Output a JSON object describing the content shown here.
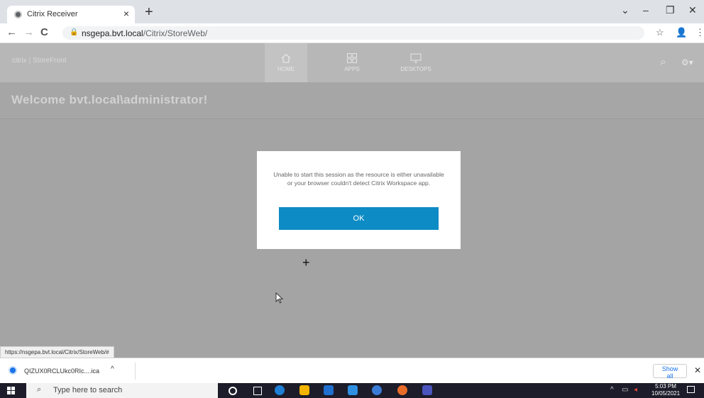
{
  "browser": {
    "tab_title": "Citrix Receiver",
    "tab_close": "×",
    "new_tab": "+",
    "window_controls": {
      "menu": "⌄",
      "minimize": "–",
      "restore": "❐",
      "close": "✕"
    },
    "nav": {
      "back": "←",
      "forward": "→",
      "reload": "C"
    },
    "url_host": "nsgepa.bvt.local",
    "url_path": "/Citrix/StoreWeb/",
    "lock_icon": "🔒",
    "bookmark_icon": "☆",
    "profile_icon": "👤",
    "menu_icon": "⋮"
  },
  "storefront": {
    "logo_brand": "citrix",
    "logo_product": "StoreFront",
    "nav": [
      {
        "label": "HOME",
        "icon": "home-icon",
        "active": true
      },
      {
        "label": "APPS",
        "icon": "apps-grid-icon",
        "active": false
      },
      {
        "label": "DESKTOPS",
        "icon": "desktop-icon",
        "active": false
      }
    ],
    "search_icon": "⌕",
    "settings_icon": "⚙▾",
    "welcome": "Welcome bvt.local\\administrator!"
  },
  "dialog": {
    "message": "Unable to start this session as the resource is either unavailable or your browser couldn't detect Citrix Workspace app.",
    "ok_label": "OK"
  },
  "cursor": {
    "crosshair": "+"
  },
  "status_url": "https://nsgepa.bvt.local/Citrix/StoreWeb/#",
  "downloads": {
    "file_name": "QIZUX0RCLUkc0RIc....ica",
    "caret": "^",
    "show_all": "Show all",
    "close": "✕"
  },
  "taskbar": {
    "search_placeholder": "Type here to search",
    "search_icon": "⌕",
    "tray_chevron": "^",
    "time": "5:03 PM",
    "date": "10/05/2021",
    "colors": {
      "edge": "#1e7fd4",
      "explorer": "#f2b400",
      "store": "#1f6fce",
      "mail": "#2f8fe0",
      "chrome_like": "#3a7bd5",
      "firefox_like": "#e86b2a",
      "teams": "#4b53bc"
    }
  },
  "colors": {
    "accent": "#0c8bc5",
    "overlay": "#a4a4a4",
    "header": "#b7b7b7"
  }
}
